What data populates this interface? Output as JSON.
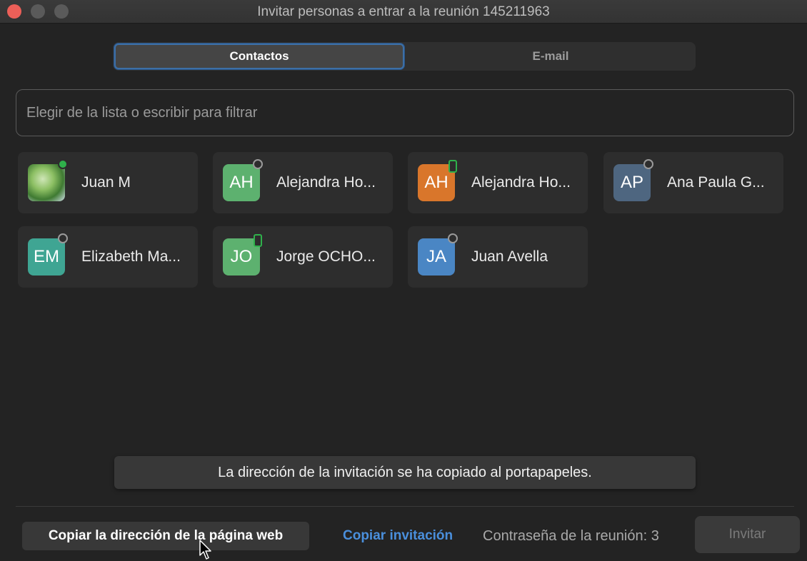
{
  "window": {
    "title": "Invitar personas a entrar a la reunión 145211963"
  },
  "tabs": [
    {
      "label": "Contactos",
      "active": true
    },
    {
      "label": "E-mail",
      "active": false
    }
  ],
  "search": {
    "placeholder": "Elegir de la lista o escribir para filtrar",
    "value": ""
  },
  "contacts": [
    {
      "name": "Juan M",
      "initials": "",
      "avatar": "photo",
      "color": "",
      "status": "online"
    },
    {
      "name": "Alejandra Ho...",
      "initials": "AH",
      "avatar": "initials",
      "color": "#5db16f",
      "status": "away"
    },
    {
      "name": "Alejandra Ho...",
      "initials": "AH",
      "avatar": "initials",
      "color": "#d9762b",
      "status": "mobile"
    },
    {
      "name": "Ana Paula G...",
      "initials": "AP",
      "avatar": "initials",
      "color": "#4e6680",
      "status": "away"
    },
    {
      "name": "Elizabeth Ma...",
      "initials": "EM",
      "avatar": "initials",
      "color": "#3fa593",
      "status": "away"
    },
    {
      "name": "Jorge OCHO...",
      "initials": "JO",
      "avatar": "initials",
      "color": "#5db16f",
      "status": "mobile"
    },
    {
      "name": "Juan Avella",
      "initials": "JA",
      "avatar": "initials",
      "color": "#4a86c4",
      "status": "away"
    }
  ],
  "toast": {
    "message": "La dirección de la invitación se ha copiado al portapapeles."
  },
  "footer": {
    "copy_url_label": "Copiar la dirección de la página web",
    "copy_invitation_label": "Copiar invitación",
    "password_text": "Contraseña de la reunión: 3",
    "invite_label": "Invitar"
  },
  "colors": {
    "accent_blue": "#4a8fdc",
    "online_green": "#2fb14b",
    "close_red": "#ec5f58"
  }
}
